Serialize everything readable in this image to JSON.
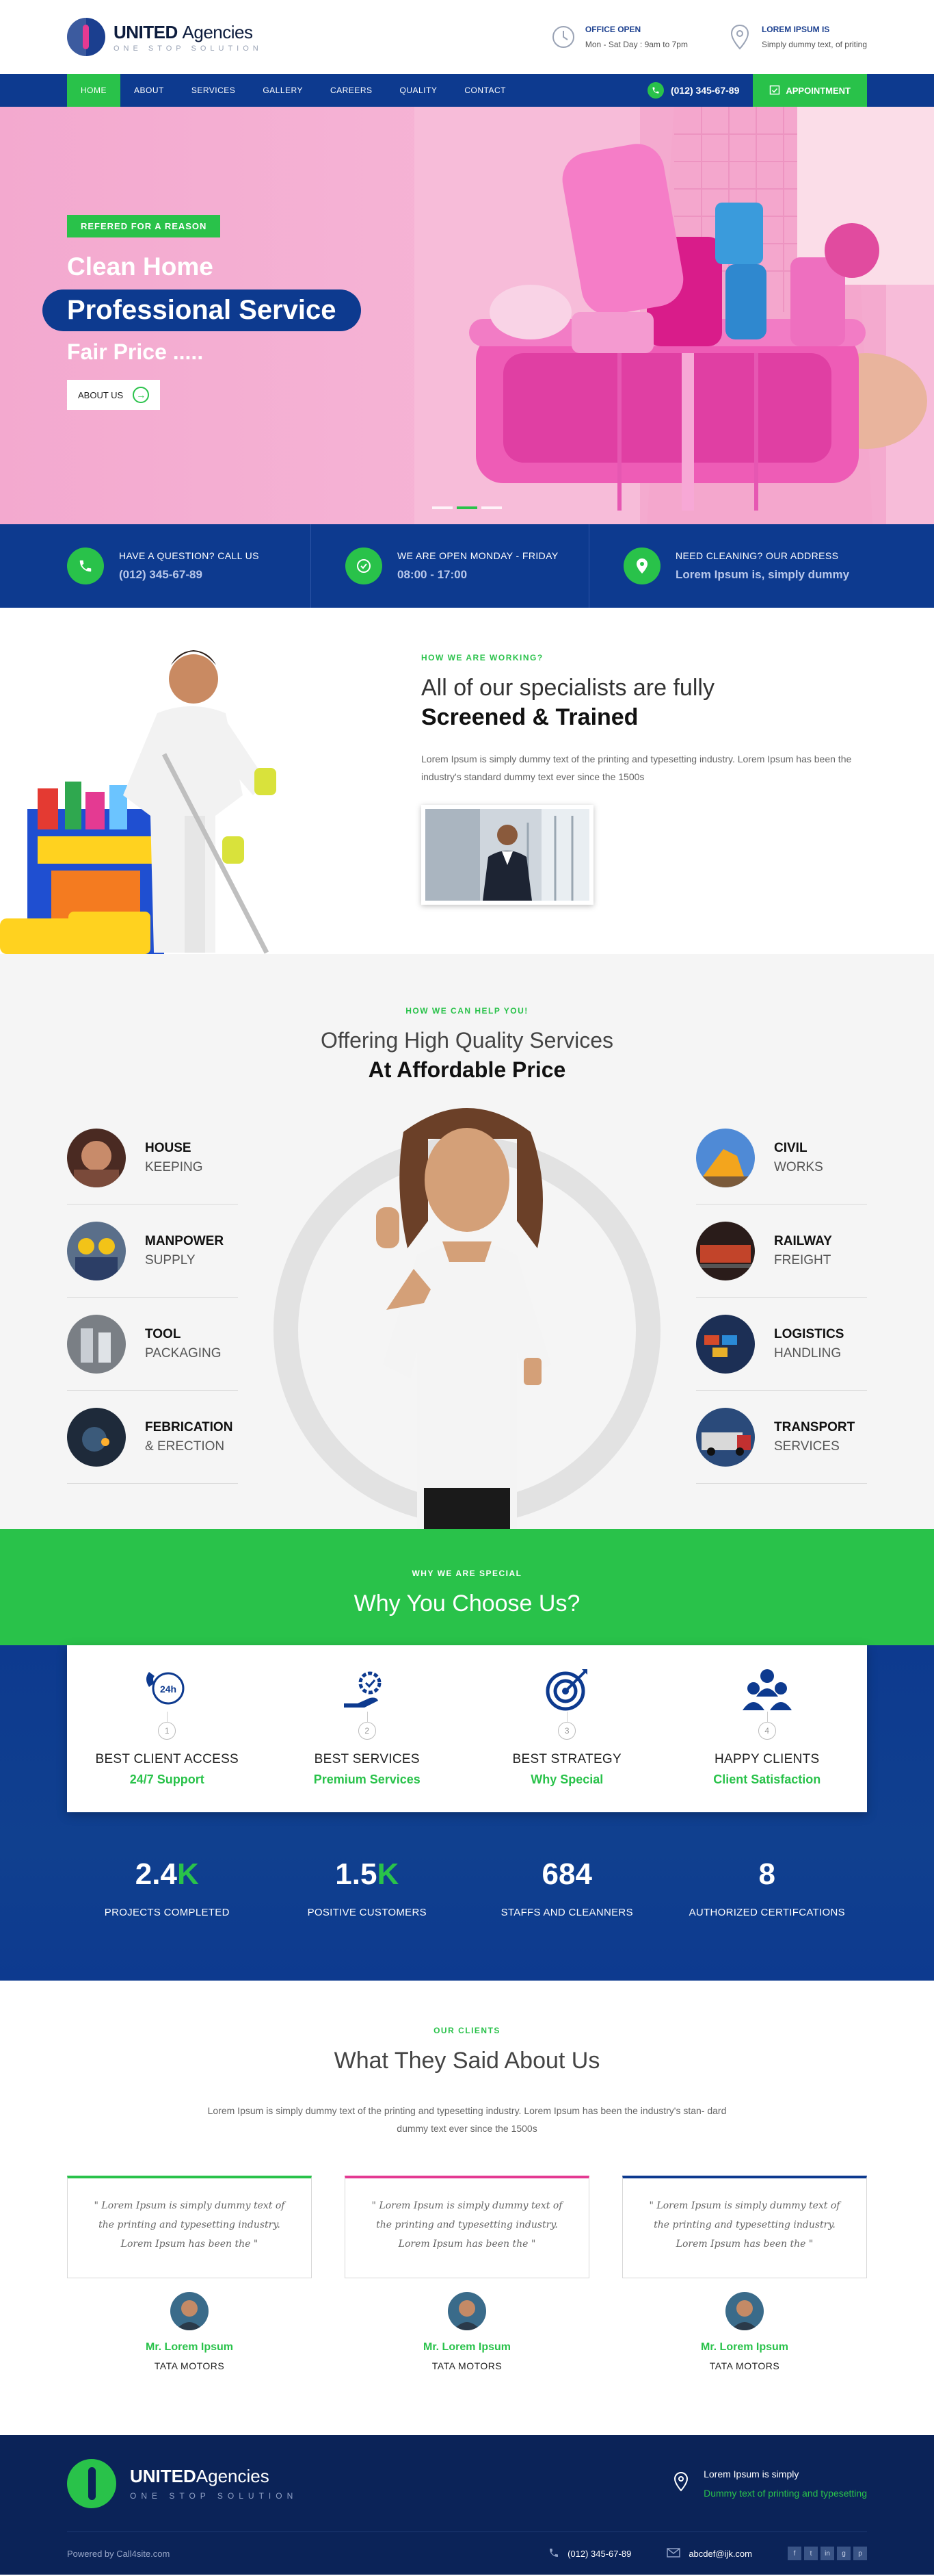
{
  "brand": {
    "name_bold": "UNITED",
    "name_light": "Agencies",
    "tagline": "ONE STOP SOLUTION"
  },
  "top_info": [
    {
      "title": "OFFICE OPEN",
      "text": "Mon - Sat Day : 9am to 7pm",
      "icon": "clock-icon"
    },
    {
      "title": "LOREM IPSUM IS",
      "text": "Simply dummy text, of priting",
      "icon": "location-pin-icon"
    }
  ],
  "nav": {
    "items": [
      "HOME",
      "ABOUT",
      "SERVICES",
      "GALLERY",
      "CAREERS",
      "QUALITY",
      "CONTACT"
    ],
    "phone": "(012) 345-67-89",
    "appointment": "APPOINTMENT"
  },
  "hero": {
    "badge": "REFERED FOR A REASON",
    "line1": "Clean Home",
    "line2": "Professional Service",
    "line3": "Fair Price .....",
    "button": "ABOUT US"
  },
  "strip": [
    {
      "label": "HAVE A QUESTION? CALL US",
      "value": "(012) 345-67-89",
      "icon": "phone-icon"
    },
    {
      "label": "WE ARE OPEN MONDAY - FRIDAY",
      "value": "08:00 - 17:00",
      "icon": "clock-icon"
    },
    {
      "label": "NEED CLEANING? OUR ADDRESS",
      "value": "Lorem Ipsum is, simply dummy",
      "icon": "location-pin-icon"
    }
  ],
  "working": {
    "eyebrow": "HOW WE ARE WORKING?",
    "heading_light": "All of our specialists are fully",
    "heading_bold": "Screened & Trained",
    "text": "Lorem Ipsum is simply dummy text of the printing and typesetting industry. Lorem Ipsum has been the industry's standard dummy text ever since the 1500s"
  },
  "services": {
    "eyebrow": "HOW WE CAN HELP YOU!",
    "heading_light": "Offering High Quality Services",
    "heading_bold": "At Affordable Price",
    "left": [
      {
        "title": "HOUSE",
        "sub": "KEEPING"
      },
      {
        "title": "MANPOWER",
        "sub": "SUPPLY"
      },
      {
        "title": "TOOL",
        "sub": "PACKAGING"
      },
      {
        "title": "FEBRICATION",
        "sub": "& ERECTION"
      }
    ],
    "right": [
      {
        "title": "CIVIL",
        "sub": "WORKS"
      },
      {
        "title": "RAILWAY",
        "sub": "FREIGHT"
      },
      {
        "title": "LOGISTICS",
        "sub": "HANDLING"
      },
      {
        "title": "TRANSPORT",
        "sub": "SERVICES"
      }
    ]
  },
  "why": {
    "eyebrow": "WHY WE ARE SPECIAL",
    "heading": "Why You Choose Us?",
    "items": [
      {
        "num": "1",
        "title": "BEST CLIENT ACCESS",
        "sub": "24/7 Support",
        "icon": "phone-24h-icon",
        "icon_text": "24h"
      },
      {
        "num": "2",
        "title": "BEST SERVICES",
        "sub": "Premium Services",
        "icon": "hand-gear-icon"
      },
      {
        "num": "3",
        "title": "BEST STRATEGY",
        "sub": "Why Special",
        "icon": "target-icon"
      },
      {
        "num": "4",
        "title": "HAPPY CLIENTS",
        "sub": "Client Satisfaction",
        "icon": "people-icon"
      }
    ],
    "stats": [
      {
        "num": "2.4",
        "suffix": "K",
        "label": "PROJECTS COMPLETED"
      },
      {
        "num": "1.5",
        "suffix": "K",
        "label": "POSITIVE CUSTOMERS"
      },
      {
        "num": "684",
        "suffix": "",
        "label": "STAFFS AND CLEANNERS"
      },
      {
        "num": "8",
        "suffix": "",
        "label": "AUTHORIZED CERTIFCATIONS"
      }
    ]
  },
  "testimonials": {
    "eyebrow": "OUR CLIENTS",
    "heading": "What They Said About Us",
    "text": "Lorem Ipsum is simply dummy text of the printing and typesetting industry. Lorem Ipsum has been the industry's stan- dard dummy text ever since the 1500s",
    "items": [
      {
        "quote": "\" Lorem Ipsum is simply dummy text of the printing and typesetting industry. Lorem Ipsum has been the \"",
        "name": "Mr. Lorem Ipsum",
        "company": "TATA MOTORS"
      },
      {
        "quote": "\" Lorem Ipsum is simply dummy text of the printing and typesetting industry. Lorem Ipsum has been the \"",
        "name": "Mr. Lorem Ipsum",
        "company": "TATA MOTORS"
      },
      {
        "quote": "\" Lorem Ipsum is simply dummy text of the printing and typesetting industry. Lorem Ipsum has been the \"",
        "name": "Mr. Lorem Ipsum",
        "company": "TATA MOTORS"
      }
    ]
  },
  "footer": {
    "address_1": "Lorem Ipsum is simply",
    "address_2": "Dummy text of printing and typesetting",
    "powered": "Powered by Call4site.com",
    "phone": "(012) 345-67-89",
    "email": "abcdef@ijk.com",
    "socials": [
      "f",
      "t",
      "in",
      "g",
      "p"
    ]
  },
  "colors": {
    "green": "#29c24a",
    "navy": "#0d3a8f",
    "pink": "#e43a92",
    "dark": "#0b2358"
  }
}
